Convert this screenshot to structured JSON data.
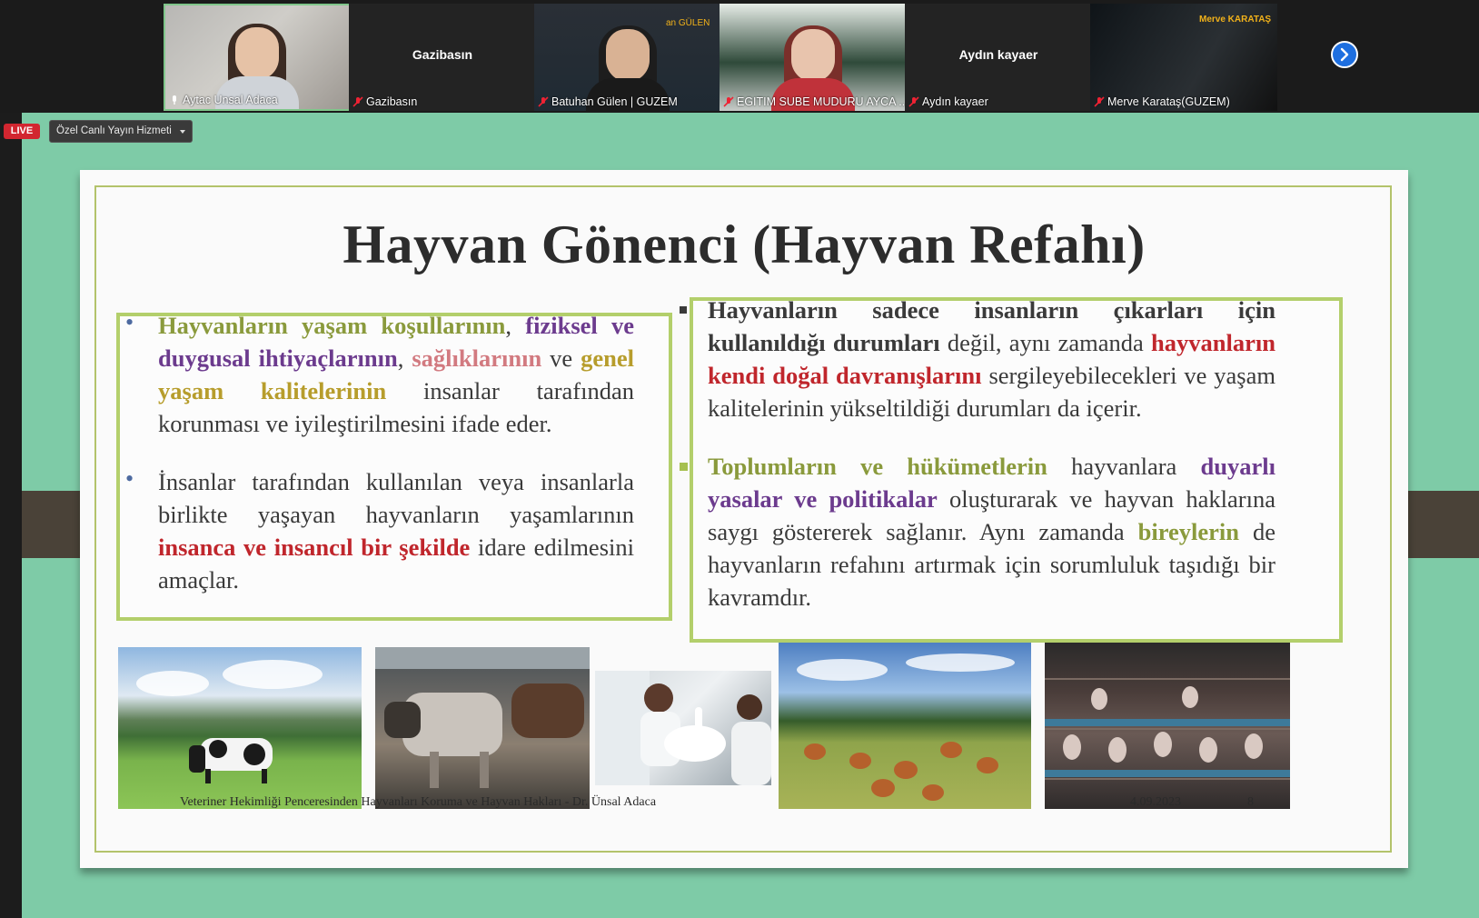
{
  "participants": [
    {
      "name": "Aytac Unsal Adaca",
      "video": true
    },
    {
      "name": "Gazibasın",
      "video": false,
      "display_name": "Gazibasın"
    },
    {
      "name": "Batuhan Gülen | GUZEM",
      "video": true,
      "overlay_text": "an GÜLEN"
    },
    {
      "name": "EGITIM SUBE MUDURU AYCA ...",
      "video": true
    },
    {
      "name": "Aydın kayaer",
      "video": false,
      "display_name": "Aydın kayaer"
    },
    {
      "name": "Merve Karataş(GUZEM)",
      "video": true,
      "overlay_text": "Merve KARATAŞ"
    }
  ],
  "header": {
    "live_label": "LIVE",
    "service_label": "Özel Canlı Yayın Hizmeti"
  },
  "slide": {
    "title": "Hayvan Gönenci (Hayvan Refahı)",
    "footer_text": "Veteriner Hekimliği Penceresinden Hayvanları Koruma ve Hayvan Hakları - Dr. Ünsal Adaca",
    "date": "4.09.2023",
    "page_number": "8",
    "left_bullets": [
      {
        "segments": [
          {
            "t": "Hayvanların yaşam koşullarının",
            "c": "g"
          },
          {
            "t": ", ",
            "c": ""
          },
          {
            "t": "fiziksel ve duygusal ihtiyaçlarının",
            "c": "p"
          },
          {
            "t": ", ",
            "c": ""
          },
          {
            "t": "sağlıklarının",
            "c": "pk"
          },
          {
            "t": " ve ",
            "c": ""
          },
          {
            "t": "genel yaşam kalitelerinin",
            "c": "o"
          },
          {
            "t": " insanlar tarafından korunması ve iyileştirilmesini ifade eder.",
            "c": ""
          }
        ]
      },
      {
        "segments": [
          {
            "t": "İnsanlar tarafından kullanılan veya insanlarla birlikte yaşayan hayvanların yaşamlarının ",
            "c": ""
          },
          {
            "t": "insanca ve insancıl bir şekilde",
            "c": "r"
          },
          {
            "t": " idare edilmesini amaçlar.",
            "c": ""
          }
        ]
      }
    ],
    "right_bullets": [
      {
        "segments": [
          {
            "t": "Hayvanların sadece insanların çıkarları için kullanıldığı durumları",
            "c": "dk"
          },
          {
            "t": " değil, aynı zamanda ",
            "c": ""
          },
          {
            "t": "hayvanların kendi doğal davranışlarını",
            "c": "r"
          },
          {
            "t": " sergileyebilecekleri ve yaşam kalitelerinin yükseltildiği durumları da içerir.",
            "c": ""
          }
        ]
      },
      {
        "segments": [
          {
            "t": "Toplumların ve hükümetlerin",
            "c": "g"
          },
          {
            "t": " hayvanlara ",
            "c": ""
          },
          {
            "t": "duyarlı yasalar ve politikalar",
            "c": "p"
          },
          {
            "t": " oluşturarak ve hayvan haklarına saygı göstererek sağlanır. Aynı zamanda ",
            "c": ""
          },
          {
            "t": "bireylerin",
            "c": "g"
          },
          {
            "t": " de hayvanların refahını artırmak için sorumluluk taşıdığı bir kavramdır.",
            "c": ""
          }
        ]
      }
    ]
  },
  "colors": {
    "stage_green": "#7ecba7",
    "frame_green": "#b3cf6b",
    "live_red": "#d22630",
    "next_blue": "#1e6fe0"
  }
}
